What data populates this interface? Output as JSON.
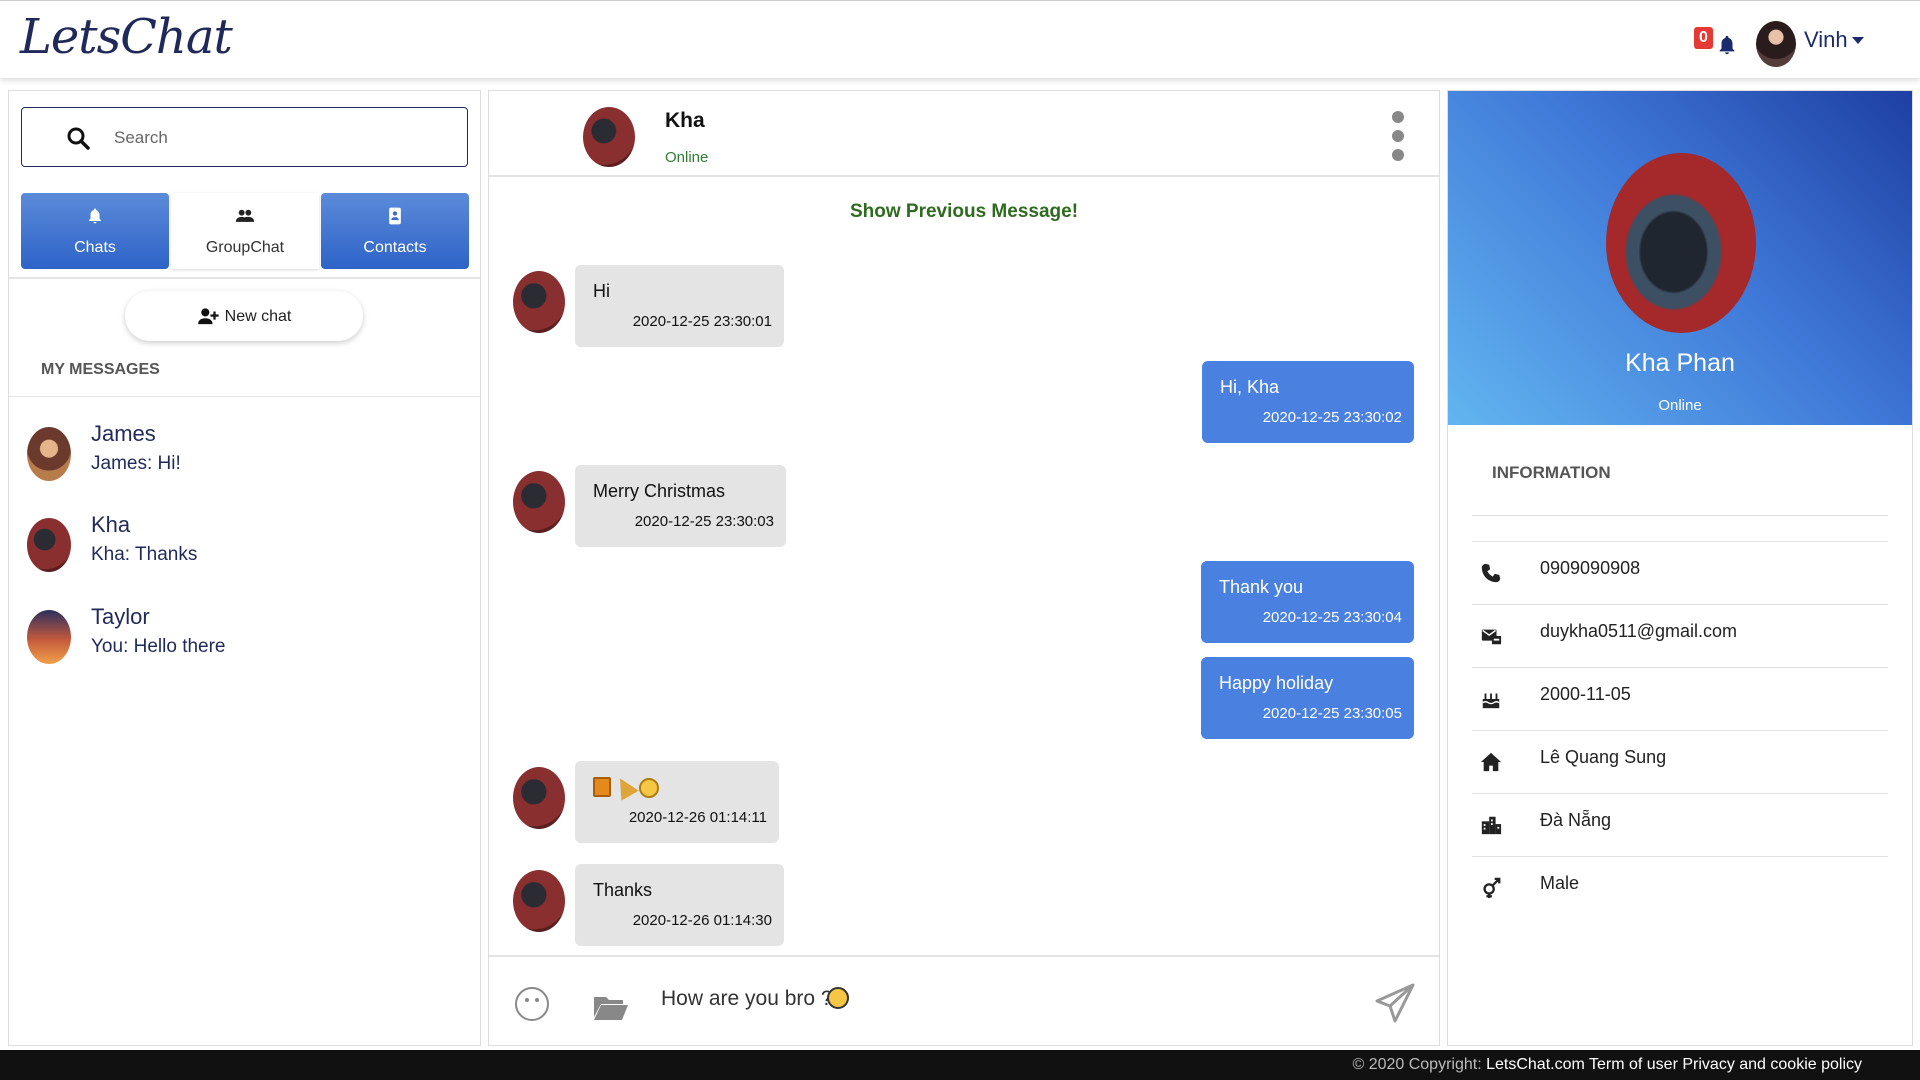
{
  "brand": {
    "logo": "LetsChat"
  },
  "header": {
    "notification_count": "0",
    "user_name": "Vinh"
  },
  "sidebar": {
    "search_placeholder": "Search",
    "tabs": [
      {
        "label": "Chats",
        "icon": "bell-icon"
      },
      {
        "label": "GroupChat",
        "icon": "users-icon"
      },
      {
        "label": "Contacts",
        "icon": "address-book-icon"
      }
    ],
    "new_chat_label": "New chat",
    "section_title": "MY MESSAGES",
    "conversations": [
      {
        "name": "James",
        "preview": "James: Hi!"
      },
      {
        "name": "Kha",
        "preview": "Kha: Thanks"
      },
      {
        "name": "Taylor",
        "preview": "You: Hello there"
      }
    ]
  },
  "chat": {
    "contact_name": "Kha",
    "contact_status": "Online",
    "show_previous": "Show Previous Message!",
    "messages": [
      {
        "direction": "in",
        "text": "Hi",
        "time": "2020-12-25 23:30:01"
      },
      {
        "direction": "out",
        "text": "Hi, Kha",
        "time": "2020-12-25 23:30:02"
      },
      {
        "direction": "in",
        "text": "Merry Christmas",
        "time": "2020-12-25 23:30:03"
      },
      {
        "direction": "out",
        "text": "Thank you",
        "time": "2020-12-25 23:30:04"
      },
      {
        "direction": "out",
        "text": "Happy holiday",
        "time": "2020-12-25 23:30:05"
      },
      {
        "direction": "in",
        "text": "",
        "emojis": [
          "gift-emoji",
          "party-horn-emoji",
          "smile-emoji"
        ],
        "time": "2020-12-26 01:14:11"
      },
      {
        "direction": "in",
        "text": "Thanks",
        "time": "2020-12-26 01:14:30"
      }
    ],
    "composer_value": "How are you bro ?"
  },
  "profile": {
    "full_name": "Kha Phan",
    "status": "Online",
    "info_title": "INFORMATION",
    "info": [
      {
        "icon": "phone-icon",
        "value": "0909090908"
      },
      {
        "icon": "mail-icon",
        "value": "duykha0511@gmail.com"
      },
      {
        "icon": "birthday-cake-icon",
        "value": "2000-11-05"
      },
      {
        "icon": "home-icon",
        "value": "Lê Quang Sung"
      },
      {
        "icon": "city-icon",
        "value": "Đà Nẵng"
      },
      {
        "icon": "gender-icon",
        "value": "Male"
      }
    ]
  },
  "footer": {
    "copyright": "© 2020 Copyright:",
    "site": "LetsChat.com",
    "terms": "Term of user",
    "privacy": "Privacy and cookie policy"
  },
  "colors": {
    "accent": "#4a80e0",
    "brand": "#1f2a5a",
    "online": "#2e7d32",
    "badge": "#e53935"
  }
}
